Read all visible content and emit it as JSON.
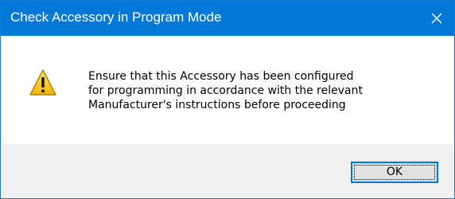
{
  "window": {
    "title": "Check Accessory in Program Mode",
    "close_icon": "close-icon",
    "titlebar_color": "#0078d7"
  },
  "message": {
    "icon": "warning-icon",
    "text": "Ensure that this Accessory has been configured\nfor programming in accordance with the relevant\nManufacturer's instructions before proceeding"
  },
  "buttons": {
    "ok_label": "OK"
  }
}
